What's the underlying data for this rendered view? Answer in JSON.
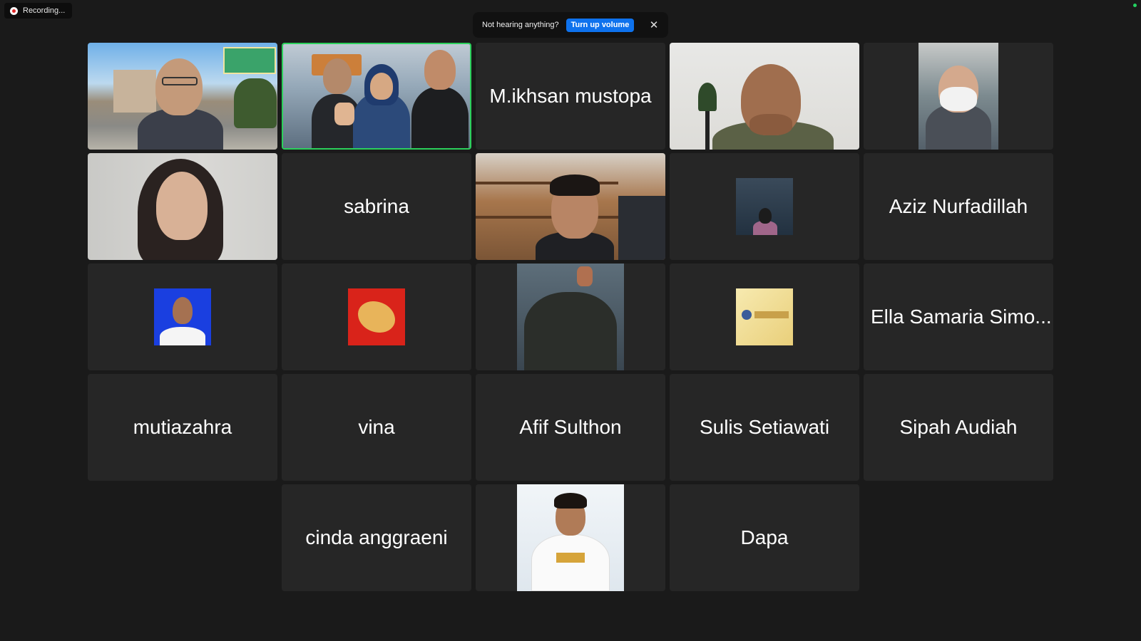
{
  "recording": {
    "label": "Recording..."
  },
  "toast": {
    "message": "Not hearing anything?",
    "button_label": "Turn up volume",
    "close_icon": "close-icon"
  },
  "participants": {
    "p03": "M.ikhsan mustopa",
    "p07": "sabrina",
    "p10": "Aziz Nurfadillah",
    "p15": "Ella Samaria Simo...",
    "p16": "mutiazahra",
    "p17": "vina",
    "p18": "Afif Sulthon",
    "p19": "Sulis Setiawati",
    "p20": "Sipah Audiah",
    "p21": "cinda anggraeni",
    "p23": "Dapa"
  },
  "colors": {
    "active_speaker_border": "#2bd05b",
    "primary_button": "#0e72ed",
    "tile_background": "#262626",
    "recording_dot": "#e02828"
  }
}
